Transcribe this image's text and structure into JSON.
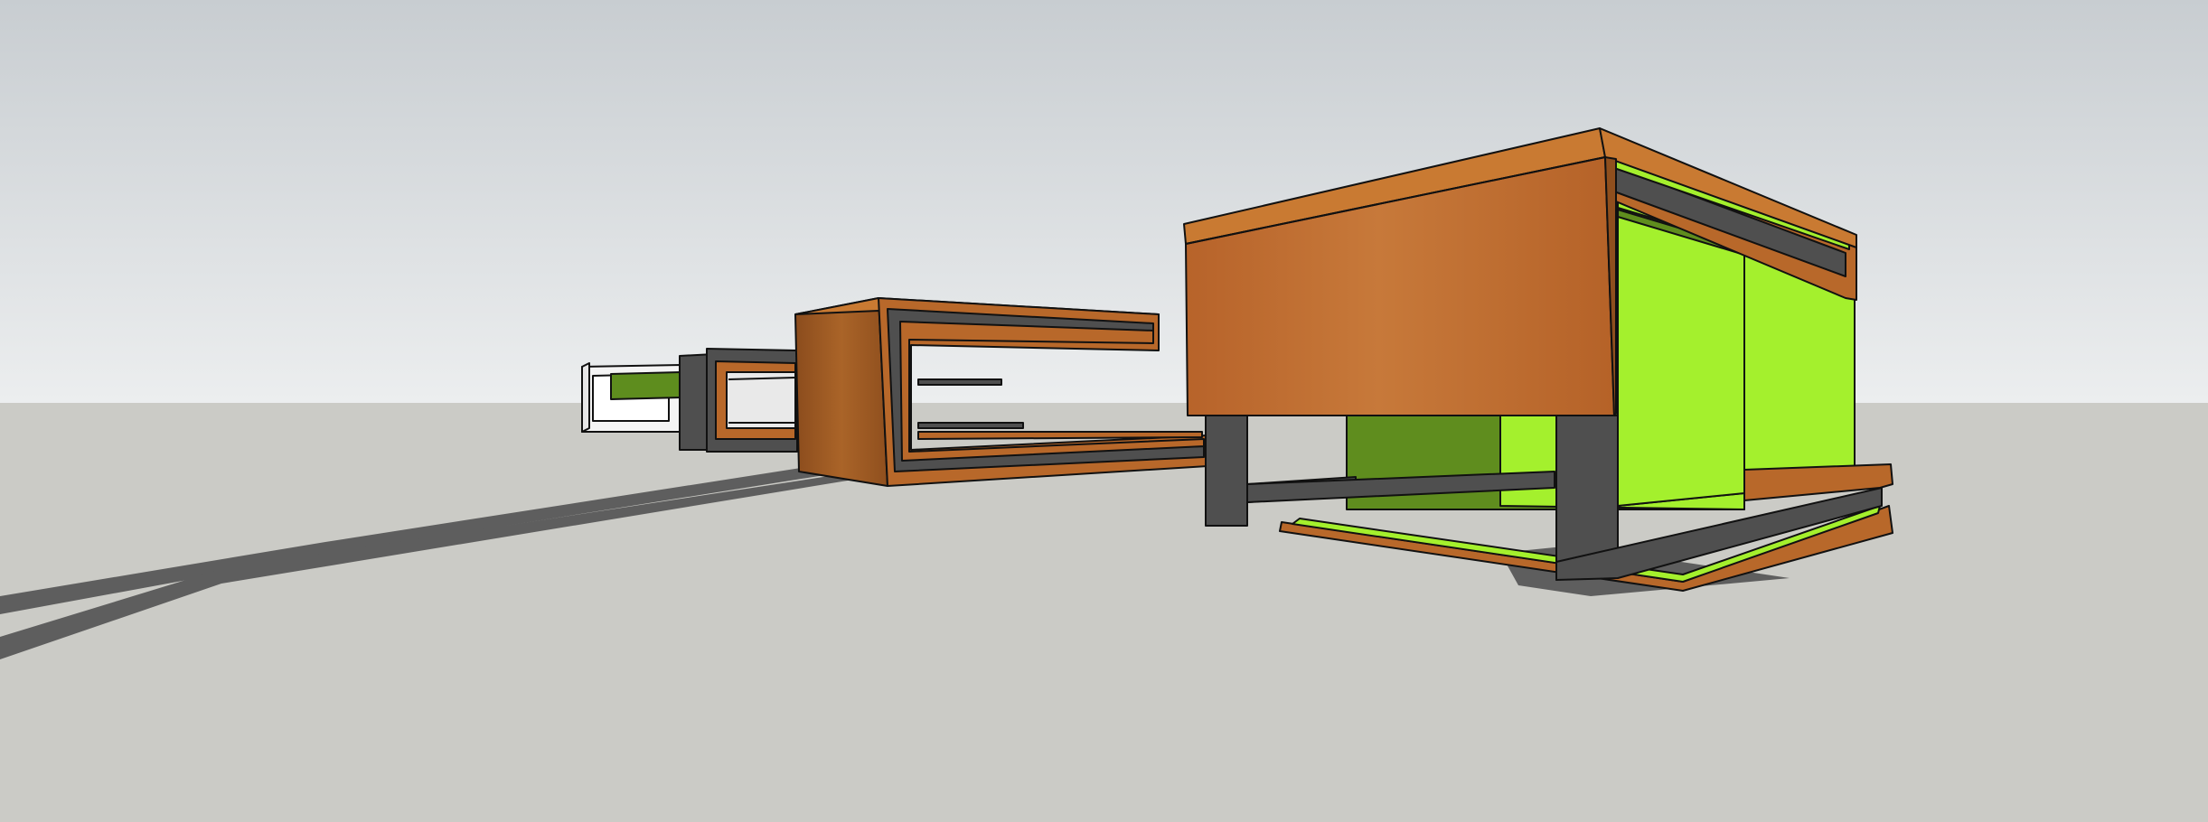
{
  "scene": {
    "sky_top_color": "#c8cdd1",
    "sky_bottom_color": "#eceeef",
    "ground_color": "#cbcbc6",
    "shadow_color": "#5e5e5e",
    "wood_color": "#b8682a",
    "wood_light_color": "#c97a32",
    "wood_dark_color": "#8f4f1e",
    "metal_color": "#4f4f4f",
    "lime_color": "#a4f02d",
    "lime_dark_color": "#5f8d1e",
    "edge_color": "#111111",
    "objects": [
      "white-module",
      "small-grey-module",
      "medium-wood-module",
      "large-cube-table"
    ]
  }
}
